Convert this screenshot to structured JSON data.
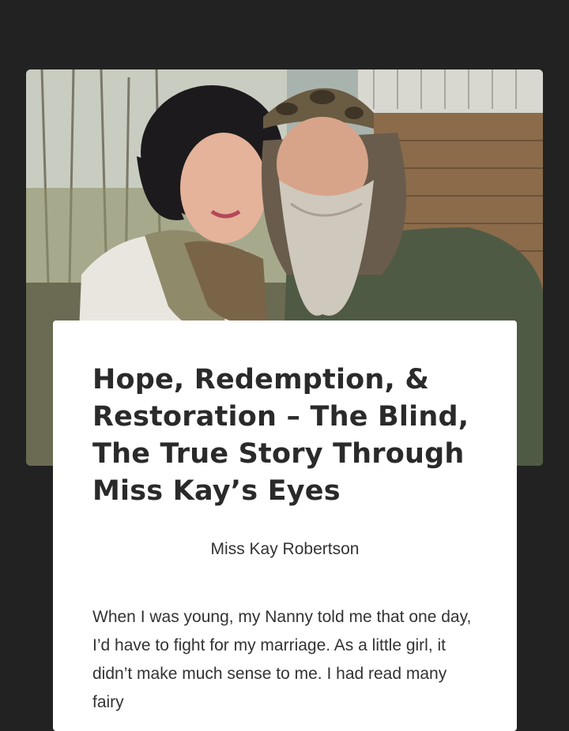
{
  "article": {
    "title": "Hope, Redemption, & Restoration – The Blind, The True Story Through Miss Kay’s Eyes",
    "author": "Miss Kay Robertson",
    "excerpt": "When I was young, my Nanny told me that one day, I’d have to fight for my marriage. As a little girl, it didn’t make much sense to me. I had read many fairy"
  },
  "colors": {
    "background": "#222222",
    "card": "#ffffff",
    "text": "#2a2a2a"
  }
}
